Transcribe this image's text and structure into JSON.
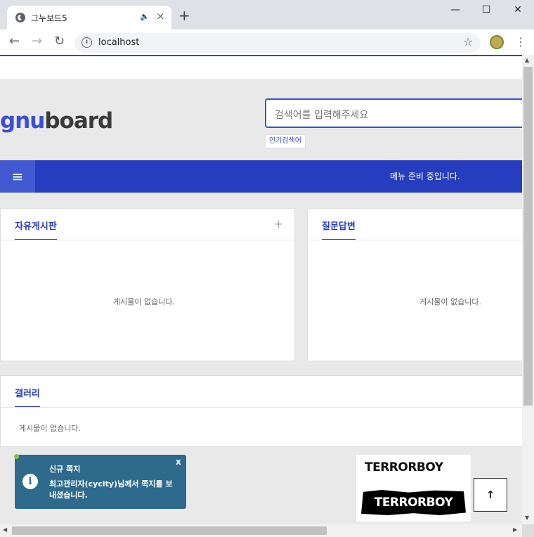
{
  "browser": {
    "tab_title": "그누보드5",
    "audio_icon": "speaker-icon",
    "tab_close": "×",
    "new_tab": "+",
    "minimize": "—",
    "maximize": "☐",
    "close": "✕",
    "back": "←",
    "forward": "→",
    "reload": "↻",
    "info": "i",
    "url": "localhost",
    "star": "☆",
    "menu": "⋮"
  },
  "site": {
    "logo_prefix": "gnu",
    "logo_suffix": "board",
    "search_placeholder": "검색어를 입력해주세요",
    "popular_label": "인기검색어",
    "menu_icon": "≡",
    "gnb_notice": "메뉴 준비 중입니다."
  },
  "panels": {
    "free": {
      "title": "자유게시판",
      "plus": "+",
      "empty": "게시물이 없습니다."
    },
    "qa": {
      "title": "질문답변",
      "empty": "게시물이 없습니다."
    },
    "gallery": {
      "title": "갤러리",
      "empty": "게시물이 없습니다."
    }
  },
  "toast": {
    "title": "신규 쪽지",
    "message": "최고관리자(cycity)님께서 쪽지를 보내셨습니다.",
    "close": "x",
    "icon": "i"
  },
  "banner": {
    "line1": "TERRORBOY",
    "line2": "TERRORBOY"
  },
  "totop": "🡑",
  "colors": {
    "accent": "#253dbe",
    "toast": "#2d6a8c"
  }
}
